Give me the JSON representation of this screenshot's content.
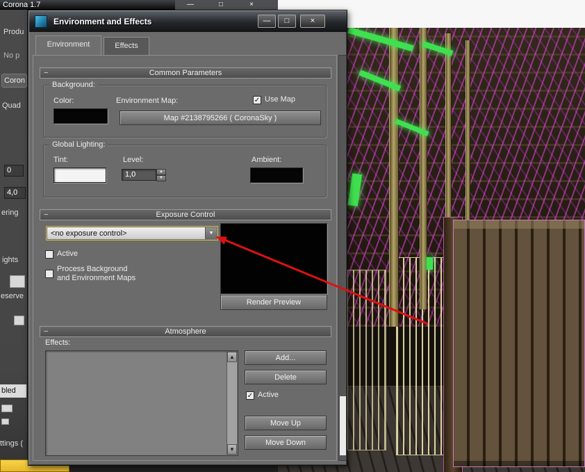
{
  "colors": {
    "arrow_red": "#dd1111",
    "selection_yellow": "#e8c53a",
    "dialog_bg": "#6b6b6b",
    "viewport_wireframe_magenta": "#d24ad2",
    "viewport_light_green": "#3fe04f"
  },
  "icons": {
    "minimize": "—",
    "maximize": "□",
    "close": "×",
    "check": "✓",
    "dropdown_arrow": "▼",
    "spinner_up": "▲",
    "spinner_down": "▼",
    "scroll_up": "▲",
    "scroll_down": "▼",
    "collapse": "−"
  },
  "main_window": {
    "title": "Corona 1.7"
  },
  "left_panel": {
    "fragments": [
      "Produ",
      "No p",
      "Coron",
      "Quad",
      "0",
      "4,0",
      "ering",
      "ights",
      "eserve",
      "bled",
      "ttings ("
    ]
  },
  "dialog": {
    "title": "Environment and Effects",
    "tabs": [
      {
        "label": "Environment"
      },
      {
        "label": "Effects"
      }
    ],
    "common": {
      "header": "Common Parameters",
      "background": {
        "label": "Background:",
        "color_label": "Color:",
        "env_map_label": "Environment Map:",
        "use_map_label": "Use Map",
        "use_map_check": "✓",
        "map_button_label": "Map #2138795266  ( CoronaSky )"
      },
      "global_lighting": {
        "label": "Global Lighting:",
        "tint_label": "Tint:",
        "level_label": "Level:",
        "level_value": "1,0",
        "ambient_label": "Ambient:"
      }
    },
    "exposure": {
      "header": "Exposure Control",
      "dropdown_value": "<no exposure control>",
      "active_label": "Active",
      "active_check": "",
      "process_line1": "Process Background",
      "process_line2": "and Environment Maps",
      "process_check": "",
      "render_preview_label": "Render Preview"
    },
    "atmosphere": {
      "header": "Atmosphere",
      "effects_label": "Effects:",
      "add_label": "Add...",
      "delete_label": "Delete",
      "active_label": "Active",
      "active_check": "✓",
      "move_up_label": "Move Up",
      "move_down_label": "Move Down"
    }
  }
}
